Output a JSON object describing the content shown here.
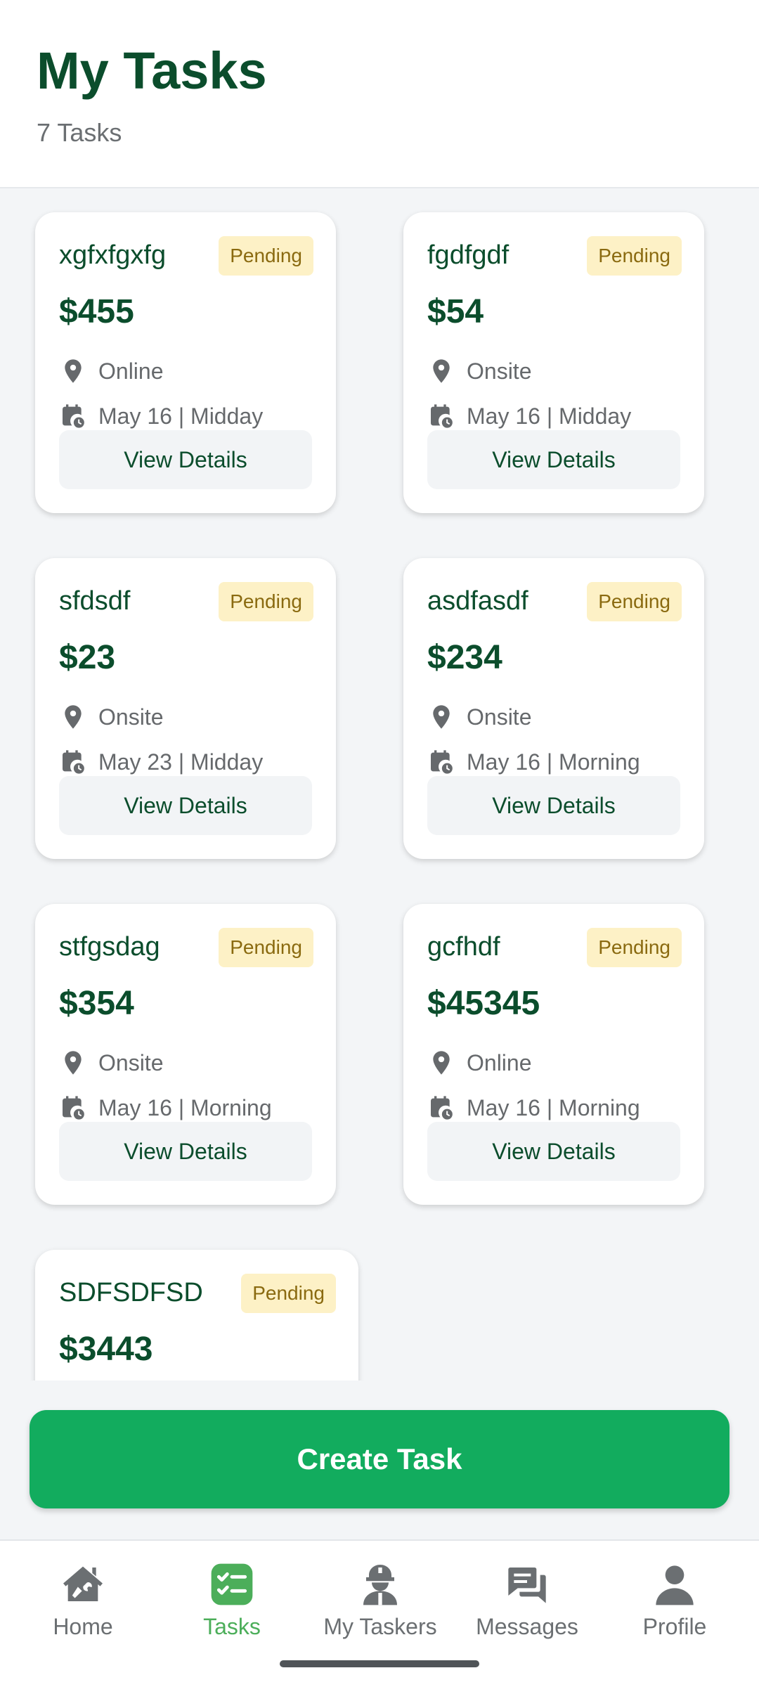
{
  "header": {
    "title": "My Tasks",
    "count": "7 Tasks"
  },
  "tasks": [
    {
      "name": "xgfxfgxfg",
      "status": "Pending",
      "price": "$455",
      "location": "Online",
      "date": "May 16 | Midday",
      "action": "View Details"
    },
    {
      "name": "fgdfgdf",
      "status": "Pending",
      "price": "$54",
      "location": "Onsite",
      "date": "May 16 | Midday",
      "action": "View Details"
    },
    {
      "name": "sfdsdf",
      "status": "Pending",
      "price": "$23",
      "location": "Onsite",
      "date": "May 23 | Midday",
      "action": "View Details"
    },
    {
      "name": "asdfasdf",
      "status": "Pending",
      "price": "$234",
      "location": "Onsite",
      "date": "May 16 | Morning",
      "action": "View Details"
    },
    {
      "name": "stfgsdag",
      "status": "Pending",
      "price": "$354",
      "location": "Onsite",
      "date": "May 16 | Morning",
      "action": "View Details"
    },
    {
      "name": "gcfhdf",
      "status": "Pending",
      "price": "$45345",
      "location": "Online",
      "date": "May 16 | Morning",
      "action": "View Details"
    },
    {
      "name": "SDFSDFSD",
      "status": "Pending",
      "price": "$3443"
    }
  ],
  "create_button": "Create Task",
  "nav": [
    {
      "label": "Home",
      "icon": "home-icon"
    },
    {
      "label": "Tasks",
      "icon": "tasks-checklist-icon",
      "active": true
    },
    {
      "label": "My Taskers",
      "icon": "worker-hardhat-icon"
    },
    {
      "label": "Messages",
      "icon": "chat-bubbles-icon"
    },
    {
      "label": "Profile",
      "icon": "person-icon"
    }
  ],
  "colors": {
    "brand_dark": "#0b4d2c",
    "accent_green": "#12ac5e",
    "nav_active": "#4cae5a",
    "badge_bg": "#fdf1c6",
    "badge_text": "#8a6a10"
  }
}
